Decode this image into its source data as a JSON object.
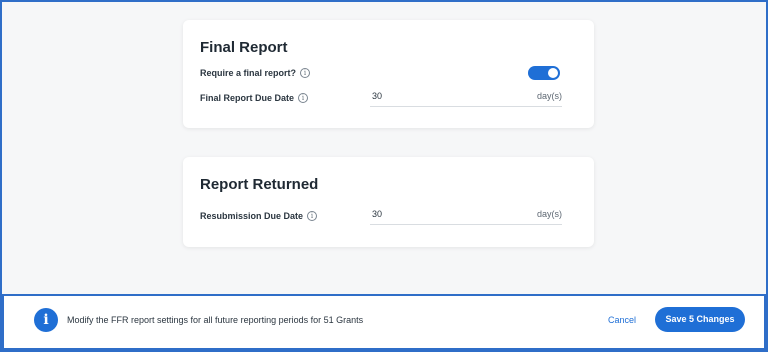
{
  "final_report": {
    "title": "Final Report",
    "require_label": "Require a final report?",
    "require_enabled": true,
    "due_label": "Final Report Due Date",
    "due_value": "30",
    "due_unit": "day(s)"
  },
  "report_returned": {
    "title": "Report Returned",
    "resubmission_label": "Resubmission Due Date",
    "resubmission_value": "30",
    "resubmission_unit": "day(s)"
  },
  "footer": {
    "message": "Modify the FFR report settings for all future reporting periods for 51 Grants",
    "cancel_label": "Cancel",
    "save_label": "Save 5 Changes"
  },
  "icons": {
    "info_small": "i",
    "info_large": "i"
  },
  "colors": {
    "accent": "#1f6fd6",
    "frame_border": "#2f6ec8"
  }
}
